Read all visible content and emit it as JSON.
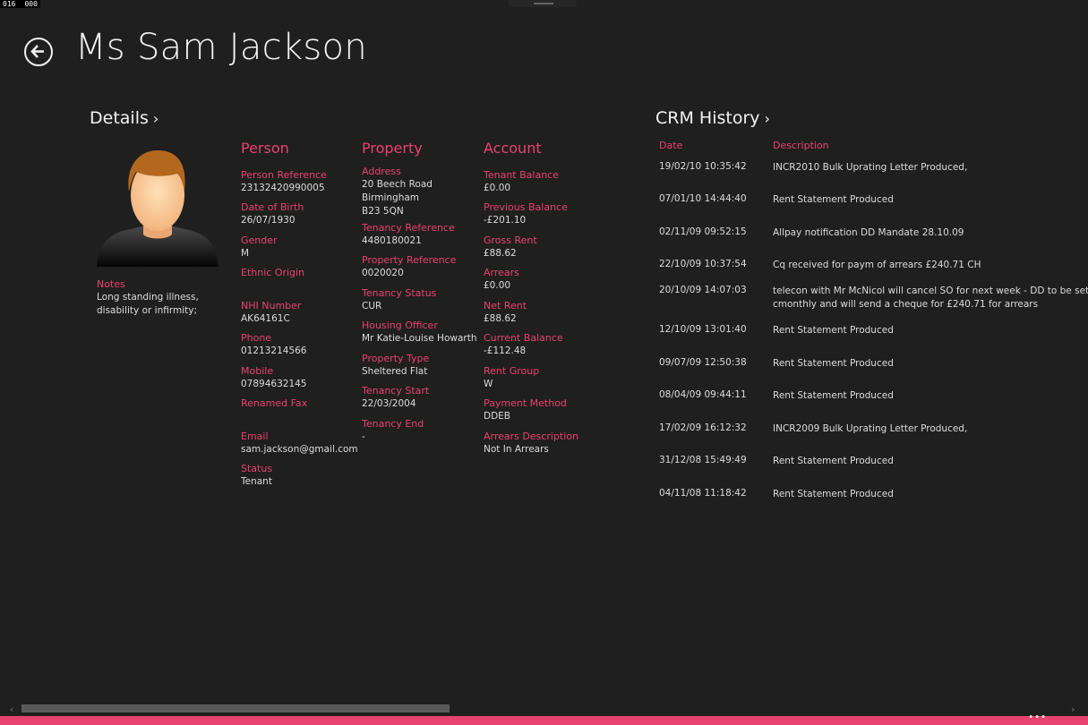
{
  "counter": {
    "a": "016",
    "b": "000"
  },
  "header": {
    "title": "Ms Sam Jackson"
  },
  "details": {
    "heading": "Details",
    "chevron": "›"
  },
  "notes": {
    "label": "Notes",
    "value_line1": "Long standing illness,",
    "value_line2": "disability or infirmity;"
  },
  "person": {
    "heading": "Person",
    "fields": [
      {
        "label": "Person Reference",
        "value": "23132420990005"
      },
      {
        "label": "Date of Birth",
        "value": "26/07/1930"
      },
      {
        "label": "Gender",
        "value": "M"
      },
      {
        "label": "Ethnic Origin",
        "value": ""
      },
      {
        "label": "NHI Number",
        "value": "AK64161C"
      },
      {
        "label": "Phone",
        "value": "01213214566"
      },
      {
        "label": "Mobile",
        "value": "07894632145"
      },
      {
        "label": "Renamed Fax",
        "value": ""
      },
      {
        "label": "Email",
        "value": "sam.jackson@gmail.com"
      },
      {
        "label": "Status",
        "value": "Tenant"
      }
    ]
  },
  "property": {
    "heading": "Property",
    "address_label": "Address",
    "address_line1": "20 Beech Road",
    "address_line2": "Birmingham",
    "address_line3": "B23 5QN",
    "fields": [
      {
        "label": "Tenancy Reference",
        "value": "4480180021"
      },
      {
        "label": "Property Reference",
        "value": "0020020"
      },
      {
        "label": "Tenancy Status",
        "value": "CUR"
      },
      {
        "label": "Housing Officer",
        "value": "Mr Katie-Louise Howarth"
      },
      {
        "label": "Property Type",
        "value": "Sheltered Flat"
      },
      {
        "label": "Tenancy Start",
        "value": "22/03/2004"
      },
      {
        "label": "Tenancy End",
        "value": "-"
      }
    ]
  },
  "account": {
    "heading": "Account",
    "fields": [
      {
        "label": "Tenant Balance",
        "value": "£0.00"
      },
      {
        "label": "Previous Balance",
        "value": "-£201.10"
      },
      {
        "label": "Gross Rent",
        "value": "£88.62"
      },
      {
        "label": "Arrears",
        "value": "£0.00"
      },
      {
        "label": "Net Rent",
        "value": "£88.62"
      },
      {
        "label": "Current Balance",
        "value": "-£112.48"
      },
      {
        "label": "Rent Group",
        "value": "W"
      },
      {
        "label": "Payment Method",
        "value": "DDEB"
      },
      {
        "label": "Arrears Description",
        "value": "Not In Arrears"
      }
    ]
  },
  "crm": {
    "heading": "CRM History",
    "chevron": "›",
    "col_date": "Date",
    "col_desc": "Description",
    "rows": [
      {
        "date": "19/02/10 10:35:42",
        "desc": "INCR2010 Bulk Uprating Letter Produced,",
        "desc2": ""
      },
      {
        "date": "07/01/10 14:44:40",
        "desc": "Rent Statement Produced",
        "desc2": ""
      },
      {
        "date": "02/11/09 09:52:15",
        "desc": "Allpay notification DD Mandate 28.10.09",
        "desc2": ""
      },
      {
        "date": "22/10/09 10:37:54",
        "desc": "Cq received for paym of arrears £240.71 CH",
        "desc2": ""
      },
      {
        "date": "20/10/09 14:07:03",
        "desc": "telecon with Mr McNicol will cancel SO for next week - DD to be set up at £",
        "desc2": "cmonthly and will send a cheque for £240.71 for arrears"
      },
      {
        "date": "12/10/09 13:01:40",
        "desc": "Rent Statement Produced",
        "desc2": ""
      },
      {
        "date": "09/07/09 12:50:38",
        "desc": "Rent Statement Produced",
        "desc2": ""
      },
      {
        "date": "08/04/09 09:44:11",
        "desc": "Rent Statement Produced",
        "desc2": ""
      },
      {
        "date": "17/02/09 16:12:32",
        "desc": "INCR2009 Bulk Uprating Letter Produced,",
        "desc2": ""
      },
      {
        "date": "31/12/08 15:49:49",
        "desc": "Rent Statement Produced",
        "desc2": ""
      },
      {
        "date": "04/11/08 11:18:42",
        "desc": "Rent Statement Produced",
        "desc2": ""
      }
    ]
  },
  "appbar": {
    "dots": "•••"
  },
  "colors": {
    "accent": "#e8426e",
    "background": "#1f1f1f",
    "text": "#dcdcdc"
  },
  "icons": {
    "back": "back-arrow-circle-icon",
    "avatar": "person-avatar-icon"
  }
}
